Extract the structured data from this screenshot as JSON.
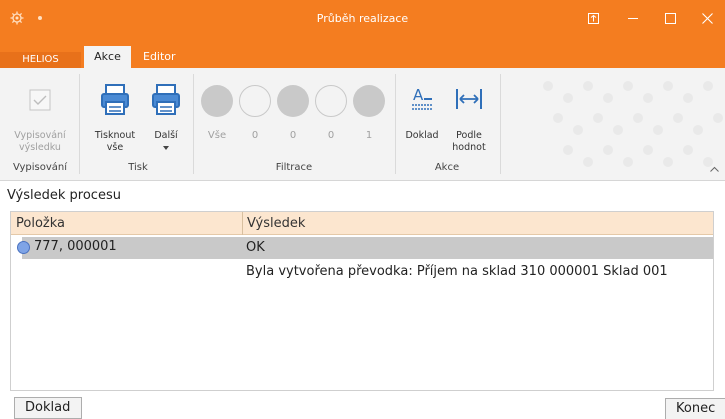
{
  "window": {
    "title": "Průběh realizace"
  },
  "titlebar_icons": [
    "settings-gear-icon",
    "ribbon-display-icon",
    "minimize-icon",
    "maximize-icon",
    "close-icon"
  ],
  "tabs": {
    "helios": "HELIOS",
    "akce": "Akce",
    "editor": "Editor"
  },
  "ribbon": {
    "vypisovani": {
      "button_line1": "Vypisování",
      "button_line2": "výsledku",
      "group": "Vypisování"
    },
    "tisk": {
      "print_all_line1": "Tisknout",
      "print_all_line2": "vše",
      "next": "Další",
      "group": "Tisk"
    },
    "filtrace": {
      "all": "Vše",
      "counts": [
        "0",
        "0",
        "0",
        "1"
      ],
      "group": "Filtrace"
    },
    "akce": {
      "doklad": "Doklad",
      "podle_line1": "Podle",
      "podle_line2": "hodnot",
      "group": "Akce"
    }
  },
  "section_title": "Výsledek procesu",
  "grid": {
    "columns": [
      "Položka",
      "Výsledek"
    ],
    "rows": [
      {
        "item": "777, 000001",
        "result": "OK",
        "selected": true
      },
      {
        "item": "",
        "result": "Byla vytvořena převodka: Příjem na sklad 310 000001 Sklad 001",
        "selected": false
      }
    ]
  },
  "buttons": {
    "doklad": "Doklad",
    "konec": "Konec"
  },
  "colors": {
    "accent": "#f47d20",
    "header_bg": "#fce6cf",
    "selected_row": "#c9c9c9",
    "status_dot": "#7fa4e6"
  }
}
